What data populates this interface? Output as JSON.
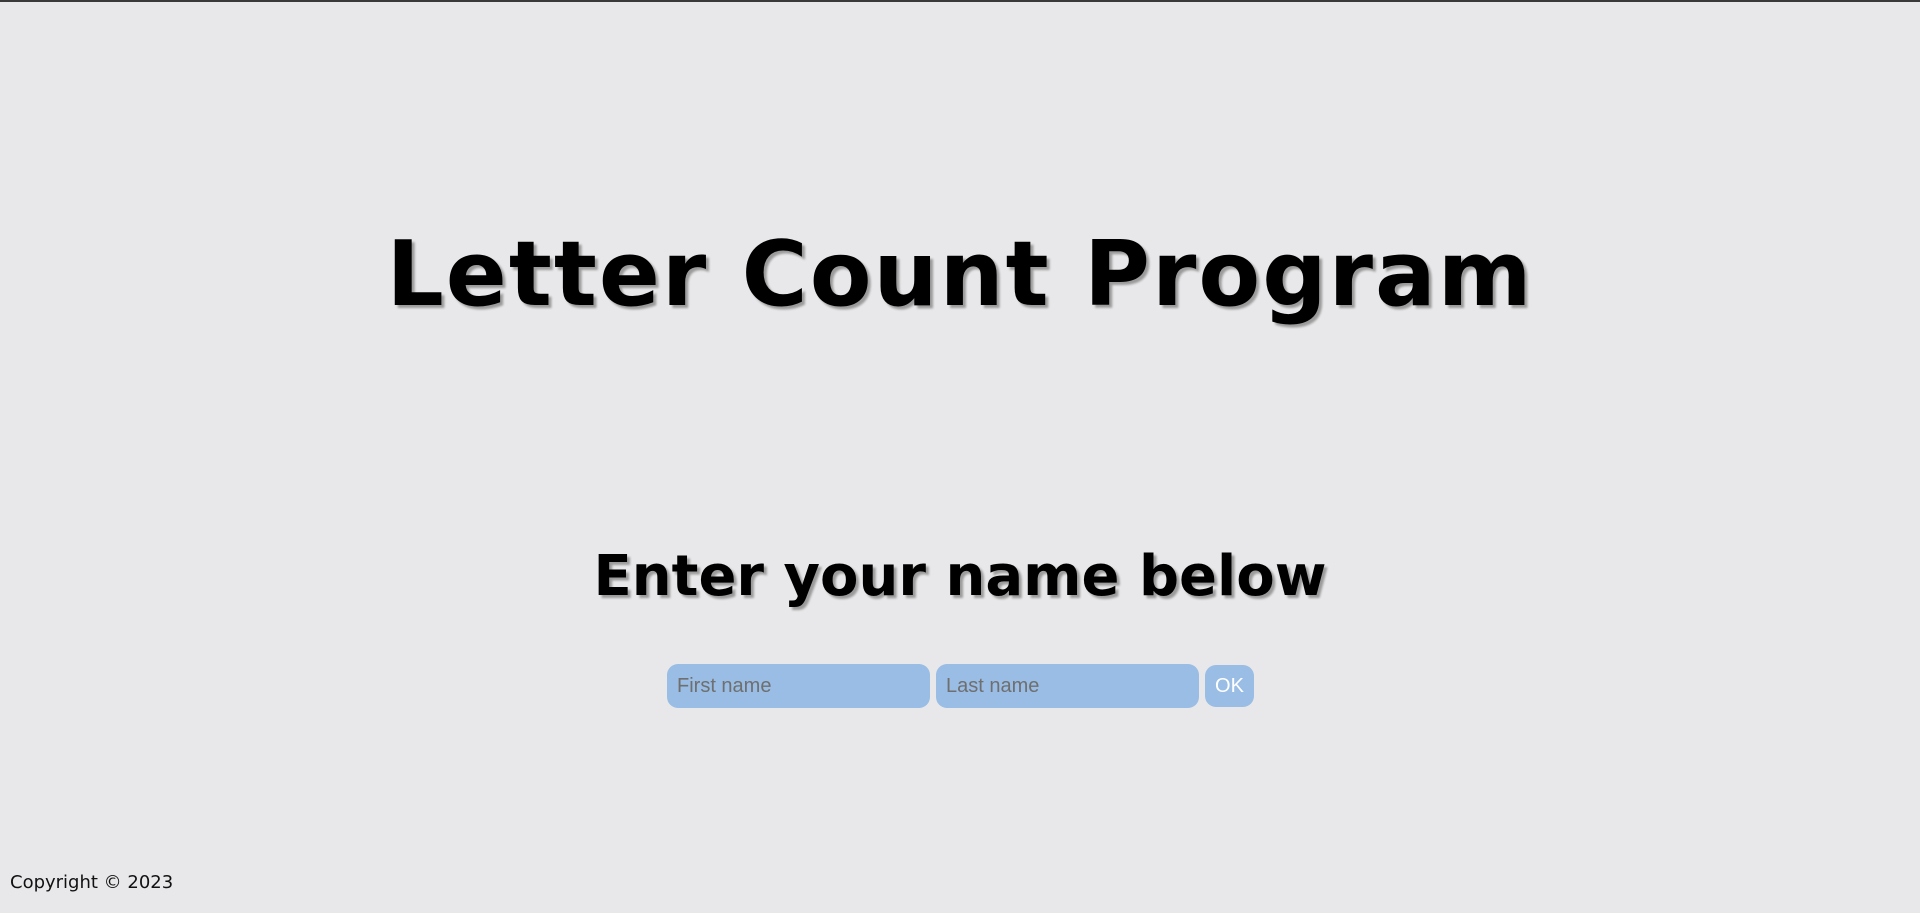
{
  "header": {
    "title": "Letter Count Program"
  },
  "main": {
    "subtitle": "Enter your name below",
    "form": {
      "first_name": {
        "value": "",
        "placeholder": "First name"
      },
      "last_name": {
        "value": "",
        "placeholder": "Last name"
      },
      "submit_label": "OK"
    }
  },
  "footer": {
    "copyright": "Copyright © 2023"
  },
  "colors": {
    "background": "#e8e8ea",
    "input_fill": "#99bde4",
    "button_text": "#ffffff",
    "title_text": "#000000"
  }
}
